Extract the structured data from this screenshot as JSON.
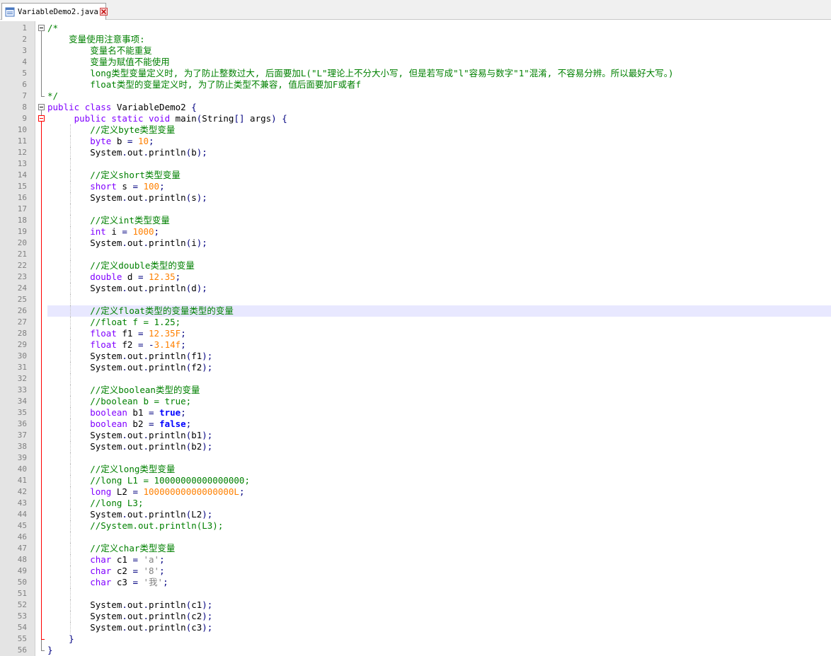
{
  "tab": {
    "filename": "VariableDemo2.java",
    "icon": "java-file-icon"
  },
  "colors": {
    "keyword": "#8000ff",
    "number": "#ff8000",
    "comment": "#008000",
    "operator": "#000080",
    "current_line": "#e8e8ff"
  },
  "current_line": 26,
  "lines": [
    {
      "n": 1,
      "indent": 0,
      "parts": [
        [
          "c",
          "/*"
        ]
      ]
    },
    {
      "n": 2,
      "indent": 1,
      "parts": [
        [
          "c",
          "    变量使用注意事项:"
        ]
      ]
    },
    {
      "n": 3,
      "indent": 2,
      "parts": [
        [
          "c",
          "        变量名不能重复"
        ]
      ]
    },
    {
      "n": 4,
      "indent": 2,
      "parts": [
        [
          "c",
          "        变量为赋值不能使用"
        ]
      ]
    },
    {
      "n": 5,
      "indent": 2,
      "parts": [
        [
          "c",
          "        long类型变量定义时, 为了防止整数过大, 后面要加L(\"L\"理论上不分大小写, 但是若写成\"l\"容易与数字\"1\"混淆, 不容易分辨。所以最好大写。)"
        ]
      ]
    },
    {
      "n": 6,
      "indent": 2,
      "parts": [
        [
          "c",
          "        float类型的变量定义时, 为了防止类型不兼容, 值后面要加F或者f"
        ]
      ]
    },
    {
      "n": 7,
      "indent": 0,
      "parts": [
        [
          "c",
          "*/"
        ]
      ]
    },
    {
      "n": 8,
      "indent": 0,
      "parts": [
        [
          "k",
          "public"
        ],
        [
          "t",
          " "
        ],
        [
          "k",
          "class"
        ],
        [
          "t",
          " VariableDemo2 "
        ],
        [
          "p",
          "{"
        ]
      ]
    },
    {
      "n": 9,
      "indent": 1,
      "parts": [
        [
          "t",
          "     "
        ],
        [
          "k",
          "public"
        ],
        [
          "t",
          " "
        ],
        [
          "k",
          "static"
        ],
        [
          "t",
          " "
        ],
        [
          "k",
          "void"
        ],
        [
          "t",
          " main"
        ],
        [
          "p",
          "("
        ],
        [
          "t",
          "String"
        ],
        [
          "p",
          "[]"
        ],
        [
          "t",
          " args"
        ],
        [
          "p",
          ")"
        ],
        [
          "t",
          " "
        ],
        [
          "p",
          "{"
        ]
      ]
    },
    {
      "n": 10,
      "indent": 2,
      "parts": [
        [
          "t",
          "        "
        ],
        [
          "c",
          "//定义byte类型变量"
        ]
      ]
    },
    {
      "n": 11,
      "indent": 2,
      "parts": [
        [
          "t",
          "        "
        ],
        [
          "k",
          "byte"
        ],
        [
          "t",
          " b "
        ],
        [
          "p",
          "="
        ],
        [
          "t",
          " "
        ],
        [
          "n",
          "10"
        ],
        [
          "p",
          ";"
        ]
      ]
    },
    {
      "n": 12,
      "indent": 2,
      "parts": [
        [
          "t",
          "        System"
        ],
        [
          "p",
          "."
        ],
        [
          "t",
          "out"
        ],
        [
          "p",
          "."
        ],
        [
          "t",
          "println"
        ],
        [
          "p",
          "("
        ],
        [
          "t",
          "b"
        ],
        [
          "p",
          ");"
        ]
      ]
    },
    {
      "n": 13,
      "indent": 2,
      "parts": []
    },
    {
      "n": 14,
      "indent": 2,
      "parts": [
        [
          "t",
          "        "
        ],
        [
          "c",
          "//定义short类型变量"
        ]
      ]
    },
    {
      "n": 15,
      "indent": 2,
      "parts": [
        [
          "t",
          "        "
        ],
        [
          "k",
          "short"
        ],
        [
          "t",
          " s "
        ],
        [
          "p",
          "="
        ],
        [
          "t",
          " "
        ],
        [
          "n",
          "100"
        ],
        [
          "p",
          ";"
        ]
      ]
    },
    {
      "n": 16,
      "indent": 2,
      "parts": [
        [
          "t",
          "        System"
        ],
        [
          "p",
          "."
        ],
        [
          "t",
          "out"
        ],
        [
          "p",
          "."
        ],
        [
          "t",
          "println"
        ],
        [
          "p",
          "("
        ],
        [
          "t",
          "s"
        ],
        [
          "p",
          ");"
        ]
      ]
    },
    {
      "n": 17,
      "indent": 2,
      "parts": []
    },
    {
      "n": 18,
      "indent": 2,
      "parts": [
        [
          "t",
          "        "
        ],
        [
          "c",
          "//定义int类型变量"
        ]
      ]
    },
    {
      "n": 19,
      "indent": 2,
      "parts": [
        [
          "t",
          "        "
        ],
        [
          "k",
          "int"
        ],
        [
          "t",
          " i "
        ],
        [
          "p",
          "="
        ],
        [
          "t",
          " "
        ],
        [
          "n",
          "1000"
        ],
        [
          "p",
          ";"
        ]
      ]
    },
    {
      "n": 20,
      "indent": 2,
      "parts": [
        [
          "t",
          "        System"
        ],
        [
          "p",
          "."
        ],
        [
          "t",
          "out"
        ],
        [
          "p",
          "."
        ],
        [
          "t",
          "println"
        ],
        [
          "p",
          "("
        ],
        [
          "t",
          "i"
        ],
        [
          "p",
          ");"
        ]
      ]
    },
    {
      "n": 21,
      "indent": 2,
      "parts": []
    },
    {
      "n": 22,
      "indent": 2,
      "parts": [
        [
          "t",
          "        "
        ],
        [
          "c",
          "//定义double类型的变量"
        ]
      ]
    },
    {
      "n": 23,
      "indent": 2,
      "parts": [
        [
          "t",
          "        "
        ],
        [
          "k",
          "double"
        ],
        [
          "t",
          " d "
        ],
        [
          "p",
          "="
        ],
        [
          "t",
          " "
        ],
        [
          "n",
          "12.35"
        ],
        [
          "p",
          ";"
        ]
      ]
    },
    {
      "n": 24,
      "indent": 2,
      "parts": [
        [
          "t",
          "        System"
        ],
        [
          "p",
          "."
        ],
        [
          "t",
          "out"
        ],
        [
          "p",
          "."
        ],
        [
          "t",
          "println"
        ],
        [
          "p",
          "("
        ],
        [
          "t",
          "d"
        ],
        [
          "p",
          ");"
        ]
      ]
    },
    {
      "n": 25,
      "indent": 2,
      "parts": []
    },
    {
      "n": 26,
      "indent": 2,
      "parts": [
        [
          "t",
          "        "
        ],
        [
          "c",
          "//定义float类型的变量类型的变量"
        ]
      ]
    },
    {
      "n": 27,
      "indent": 2,
      "parts": [
        [
          "t",
          "        "
        ],
        [
          "c",
          "//float f = 1.25;"
        ]
      ]
    },
    {
      "n": 28,
      "indent": 2,
      "parts": [
        [
          "t",
          "        "
        ],
        [
          "k",
          "float"
        ],
        [
          "t",
          " f1 "
        ],
        [
          "p",
          "="
        ],
        [
          "t",
          " "
        ],
        [
          "n",
          "12.35F"
        ],
        [
          "p",
          ";"
        ]
      ]
    },
    {
      "n": 29,
      "indent": 2,
      "parts": [
        [
          "t",
          "        "
        ],
        [
          "k",
          "float"
        ],
        [
          "t",
          " f2 "
        ],
        [
          "p",
          "="
        ],
        [
          "t",
          " "
        ],
        [
          "p",
          "-"
        ],
        [
          "n",
          "3.14f"
        ],
        [
          "p",
          ";"
        ]
      ]
    },
    {
      "n": 30,
      "indent": 2,
      "parts": [
        [
          "t",
          "        System"
        ],
        [
          "p",
          "."
        ],
        [
          "t",
          "out"
        ],
        [
          "p",
          "."
        ],
        [
          "t",
          "println"
        ],
        [
          "p",
          "("
        ],
        [
          "t",
          "f1"
        ],
        [
          "p",
          ");"
        ]
      ]
    },
    {
      "n": 31,
      "indent": 2,
      "parts": [
        [
          "t",
          "        System"
        ],
        [
          "p",
          "."
        ],
        [
          "t",
          "out"
        ],
        [
          "p",
          "."
        ],
        [
          "t",
          "println"
        ],
        [
          "p",
          "("
        ],
        [
          "t",
          "f2"
        ],
        [
          "p",
          ");"
        ]
      ]
    },
    {
      "n": 32,
      "indent": 2,
      "parts": []
    },
    {
      "n": 33,
      "indent": 2,
      "parts": [
        [
          "t",
          "        "
        ],
        [
          "c",
          "//定义boolean类型的变量"
        ]
      ]
    },
    {
      "n": 34,
      "indent": 2,
      "parts": [
        [
          "t",
          "        "
        ],
        [
          "c",
          "//boolean b = true;"
        ]
      ]
    },
    {
      "n": 35,
      "indent": 2,
      "parts": [
        [
          "t",
          "        "
        ],
        [
          "k",
          "boolean"
        ],
        [
          "t",
          " b1 "
        ],
        [
          "p",
          "="
        ],
        [
          "t",
          " "
        ],
        [
          "kb",
          "true"
        ],
        [
          "p",
          ";"
        ]
      ]
    },
    {
      "n": 36,
      "indent": 2,
      "parts": [
        [
          "t",
          "        "
        ],
        [
          "k",
          "boolean"
        ],
        [
          "t",
          " b2 "
        ],
        [
          "p",
          "="
        ],
        [
          "t",
          " "
        ],
        [
          "kb",
          "false"
        ],
        [
          "p",
          ";"
        ]
      ]
    },
    {
      "n": 37,
      "indent": 2,
      "parts": [
        [
          "t",
          "        System"
        ],
        [
          "p",
          "."
        ],
        [
          "t",
          "out"
        ],
        [
          "p",
          "."
        ],
        [
          "t",
          "println"
        ],
        [
          "p",
          "("
        ],
        [
          "t",
          "b1"
        ],
        [
          "p",
          ");"
        ]
      ]
    },
    {
      "n": 38,
      "indent": 2,
      "parts": [
        [
          "t",
          "        System"
        ],
        [
          "p",
          "."
        ],
        [
          "t",
          "out"
        ],
        [
          "p",
          "."
        ],
        [
          "t",
          "println"
        ],
        [
          "p",
          "("
        ],
        [
          "t",
          "b2"
        ],
        [
          "p",
          ");"
        ]
      ]
    },
    {
      "n": 39,
      "indent": 2,
      "parts": []
    },
    {
      "n": 40,
      "indent": 2,
      "parts": [
        [
          "t",
          "        "
        ],
        [
          "c",
          "//定义long类型变量"
        ]
      ]
    },
    {
      "n": 41,
      "indent": 2,
      "parts": [
        [
          "t",
          "        "
        ],
        [
          "c",
          "//long L1 = 10000000000000000;"
        ]
      ]
    },
    {
      "n": 42,
      "indent": 2,
      "parts": [
        [
          "t",
          "        "
        ],
        [
          "k",
          "long"
        ],
        [
          "t",
          " L2 "
        ],
        [
          "p",
          "="
        ],
        [
          "t",
          " "
        ],
        [
          "n",
          "10000000000000000L"
        ],
        [
          "p",
          ";"
        ]
      ]
    },
    {
      "n": 43,
      "indent": 2,
      "parts": [
        [
          "t",
          "        "
        ],
        [
          "c",
          "//long L3;"
        ]
      ]
    },
    {
      "n": 44,
      "indent": 2,
      "parts": [
        [
          "t",
          "        System"
        ],
        [
          "p",
          "."
        ],
        [
          "t",
          "out"
        ],
        [
          "p",
          "."
        ],
        [
          "t",
          "println"
        ],
        [
          "p",
          "("
        ],
        [
          "t",
          "L2"
        ],
        [
          "p",
          ");"
        ]
      ]
    },
    {
      "n": 45,
      "indent": 2,
      "parts": [
        [
          "t",
          "        "
        ],
        [
          "c",
          "//System.out.println(L3);"
        ]
      ]
    },
    {
      "n": 46,
      "indent": 2,
      "parts": []
    },
    {
      "n": 47,
      "indent": 2,
      "parts": [
        [
          "t",
          "        "
        ],
        [
          "c",
          "//定义char类型变量"
        ]
      ]
    },
    {
      "n": 48,
      "indent": 2,
      "parts": [
        [
          "t",
          "        "
        ],
        [
          "k",
          "char"
        ],
        [
          "t",
          " c1 "
        ],
        [
          "p",
          "="
        ],
        [
          "t",
          " "
        ],
        [
          "ch",
          "'a'"
        ],
        [
          "p",
          ";"
        ]
      ]
    },
    {
      "n": 49,
      "indent": 2,
      "parts": [
        [
          "t",
          "        "
        ],
        [
          "k",
          "char"
        ],
        [
          "t",
          " c2 "
        ],
        [
          "p",
          "="
        ],
        [
          "t",
          " "
        ],
        [
          "ch",
          "'8'"
        ],
        [
          "p",
          ";"
        ]
      ]
    },
    {
      "n": 50,
      "indent": 2,
      "parts": [
        [
          "t",
          "        "
        ],
        [
          "k",
          "char"
        ],
        [
          "t",
          " c3 "
        ],
        [
          "p",
          "="
        ],
        [
          "t",
          " "
        ],
        [
          "ch",
          "'我'"
        ],
        [
          "p",
          ";"
        ]
      ]
    },
    {
      "n": 51,
      "indent": 2,
      "parts": []
    },
    {
      "n": 52,
      "indent": 2,
      "parts": [
        [
          "t",
          "        System"
        ],
        [
          "p",
          "."
        ],
        [
          "t",
          "out"
        ],
        [
          "p",
          "."
        ],
        [
          "t",
          "println"
        ],
        [
          "p",
          "("
        ],
        [
          "t",
          "c1"
        ],
        [
          "p",
          ");"
        ]
      ]
    },
    {
      "n": 53,
      "indent": 2,
      "parts": [
        [
          "t",
          "        System"
        ],
        [
          "p",
          "."
        ],
        [
          "t",
          "out"
        ],
        [
          "p",
          "."
        ],
        [
          "t",
          "println"
        ],
        [
          "p",
          "("
        ],
        [
          "t",
          "c2"
        ],
        [
          "p",
          ");"
        ]
      ]
    },
    {
      "n": 54,
      "indent": 2,
      "parts": [
        [
          "t",
          "        System"
        ],
        [
          "p",
          "."
        ],
        [
          "t",
          "out"
        ],
        [
          "p",
          "."
        ],
        [
          "t",
          "println"
        ],
        [
          "p",
          "("
        ],
        [
          "t",
          "c3"
        ],
        [
          "p",
          ");"
        ]
      ]
    },
    {
      "n": 55,
      "indent": 1,
      "parts": [
        [
          "t",
          "    "
        ],
        [
          "p",
          "}"
        ]
      ]
    },
    {
      "n": 56,
      "indent": 0,
      "parts": [
        [
          "p",
          "}"
        ]
      ]
    }
  ]
}
